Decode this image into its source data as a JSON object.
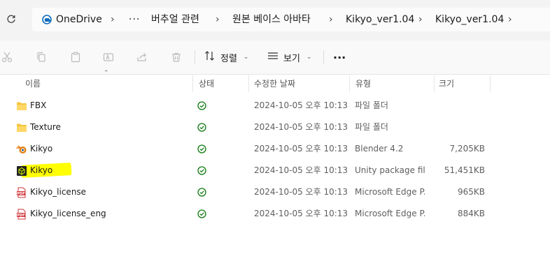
{
  "address_bar": {
    "crumbs": [
      "OneDrive",
      "버추얼 관련",
      "원본 베이스 아바타",
      "Kikyo_ver1.04",
      "Kikyo_ver1.04"
    ],
    "overflow_label": "···"
  },
  "toolbar": {
    "sort_label": "정렬",
    "view_label": "보기",
    "more_label": "···"
  },
  "columns": {
    "name": "이름",
    "status": "상태",
    "modified": "수정한 날짜",
    "type": "유형",
    "size": "크기"
  },
  "files": [
    {
      "name": "FBX",
      "modified": "2024-10-05 오후 10:13",
      "type": "파일 폴더",
      "size": "",
      "icon": "folder-icon"
    },
    {
      "name": "Texture",
      "modified": "2024-10-05 오후 10:13",
      "type": "파일 폴더",
      "size": "",
      "icon": "folder-icon"
    },
    {
      "name": "Kikyo",
      "modified": "2024-10-05 오후 10:13",
      "type": "Blender 4.2",
      "size": "7,205KB",
      "icon": "blender-icon"
    },
    {
      "name": "Kikyo",
      "modified": "2024-10-05 오후 10:13",
      "type": "Unity package file",
      "size": "51,451KB",
      "icon": "unity-package-icon"
    },
    {
      "name": "Kikyo_license",
      "modified": "2024-10-05 오후 10:13",
      "type": "Microsoft Edge P...",
      "size": "965KB",
      "icon": "pdf-icon"
    },
    {
      "name": "Kikyo_license_eng",
      "modified": "2024-10-05 오후 10:13",
      "type": "Microsoft Edge P...",
      "size": "884KB",
      "icon": "pdf-icon"
    }
  ],
  "colors": {
    "status_green": "#107c10",
    "folder_yellow": "#f5c542",
    "highlight": "#ffff00",
    "pdf_red": "#d13438",
    "blender_orange": "#e87d0d"
  }
}
